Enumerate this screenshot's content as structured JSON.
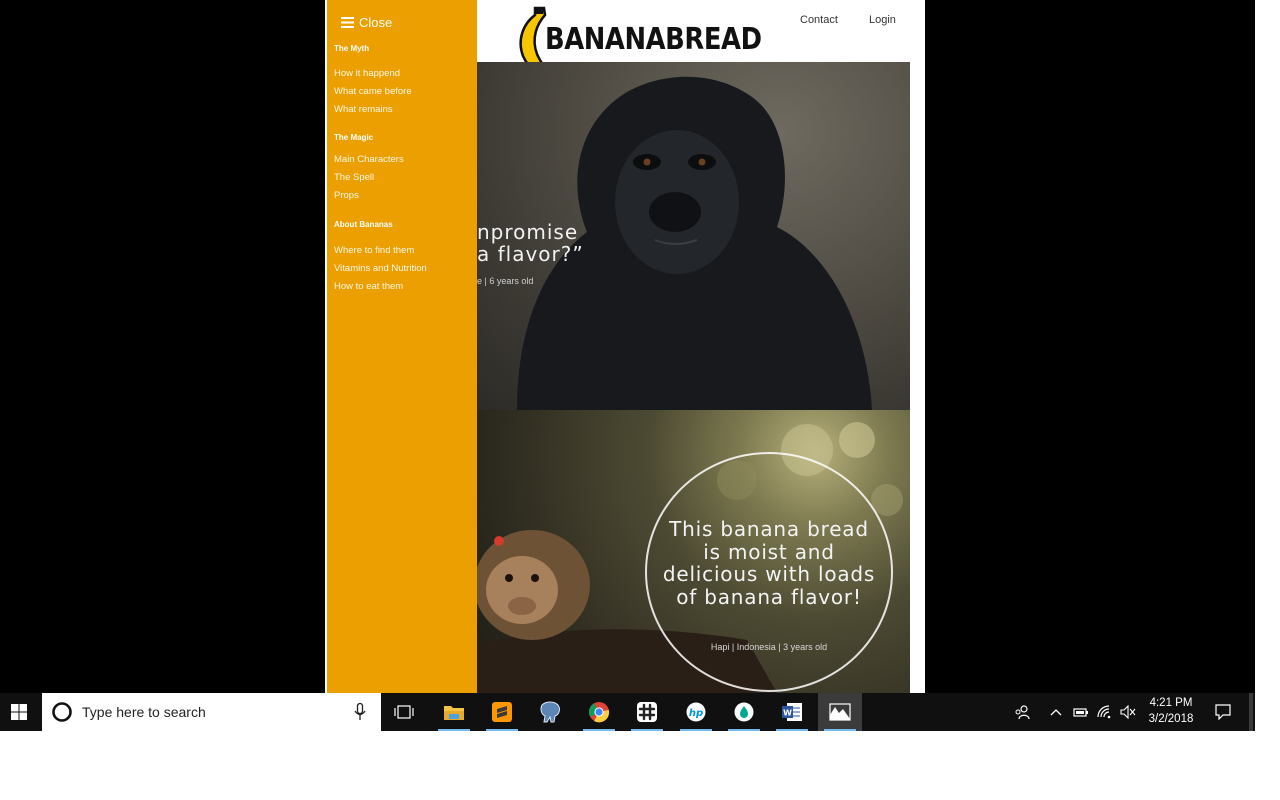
{
  "site": {
    "brand": "BANANABREAD",
    "nav": {
      "contact": "Contact",
      "login": "Login"
    }
  },
  "menu": {
    "close_label": "Close",
    "sections": [
      {
        "heading": "The Myth",
        "items": [
          "How it happend",
          "What came before",
          "What remains"
        ]
      },
      {
        "heading": "The Magic",
        "items": [
          "Main Characters",
          "The Spell",
          "Props"
        ]
      },
      {
        "heading": "About Bananas",
        "items": [
          "Where to find them",
          "Vitamins and Nutrition",
          "How to eat them"
        ]
      }
    ]
  },
  "hero1": {
    "quote_line1": "npromise",
    "quote_line2": "a flavor?”",
    "author": "e | 6 years old"
  },
  "hero2": {
    "quote": "This banana bread is moist and delicious with loads of banana flavor!",
    "author": "Hapi | Indonesia | 3 years old"
  },
  "taskbar": {
    "search_placeholder": "Type here to search",
    "time": "4:21 PM",
    "date": "3/2/2018",
    "apps": [
      "task-view-icon",
      "file-explorer-icon",
      "sublime-text-icon",
      "postgresql-icon",
      "chrome-icon",
      "slack-icon",
      "hp-icon",
      "drop-app-icon",
      "word-icon",
      "photos-icon"
    ]
  },
  "colors": {
    "menu_bg": "#ec9f00",
    "taskbar_bg": "#101010",
    "accent": "#76b9ed"
  }
}
